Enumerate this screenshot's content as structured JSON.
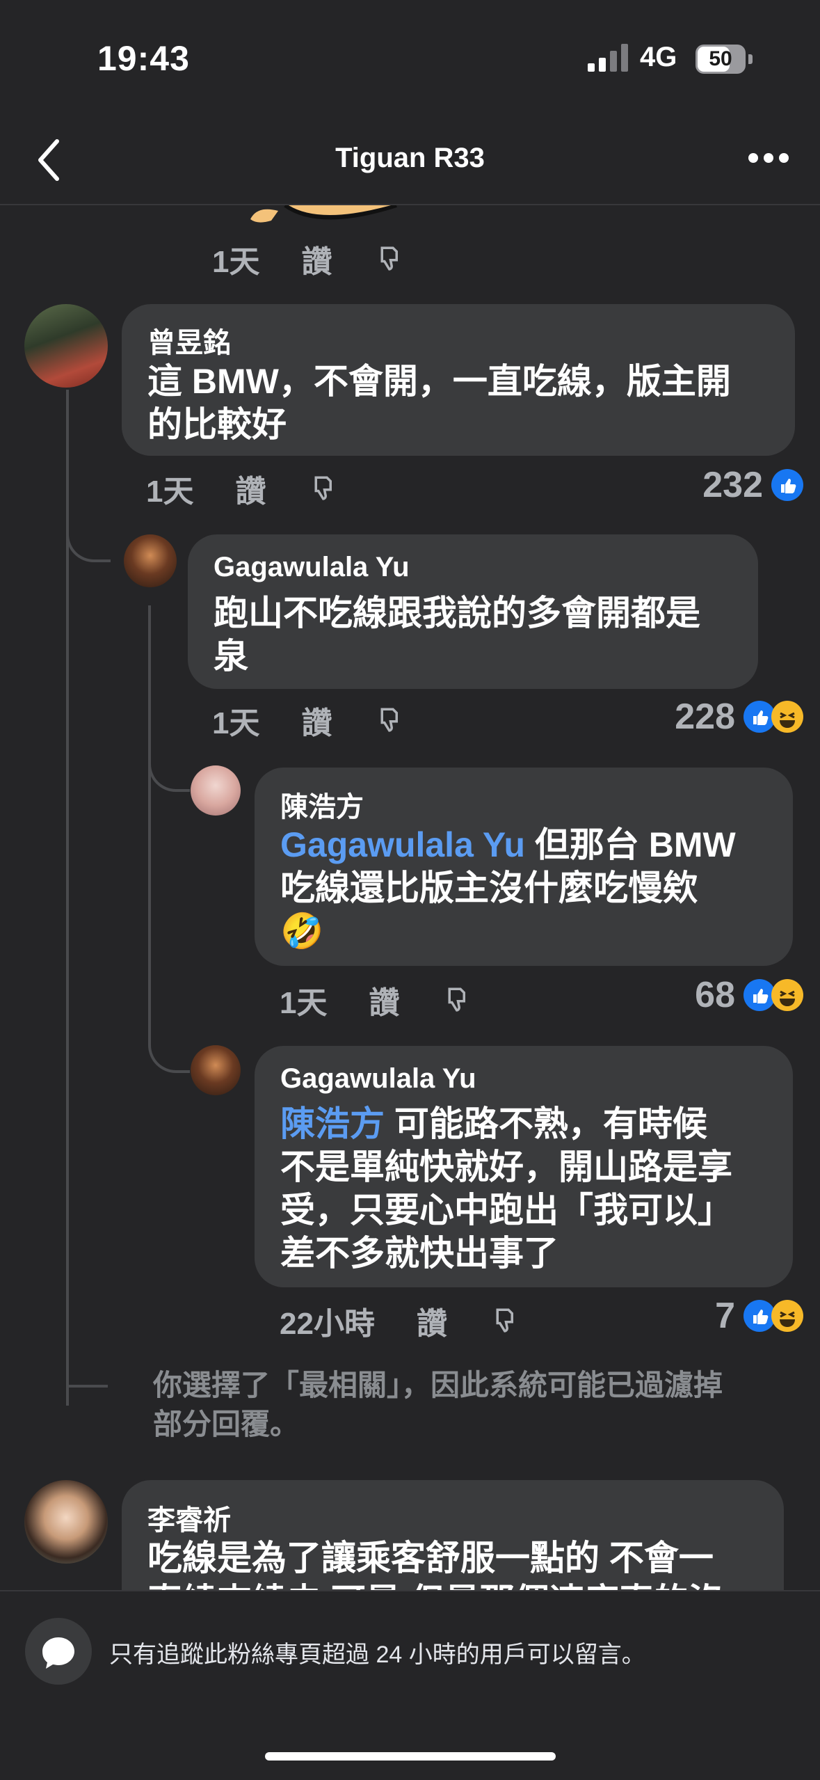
{
  "status_bar": {
    "time": "19:43",
    "network": "4G",
    "battery": "50"
  },
  "header": {
    "title": "Tiguan R33"
  },
  "prev_comment_meta": {
    "time": "1天",
    "like": "讚"
  },
  "comments": [
    {
      "author": "曾昱銘",
      "line1": "這 BMW，不會開，一直吃線，版主開",
      "line2": "的比較好",
      "time": "1天",
      "like": "讚",
      "count": "232"
    },
    {
      "author": "Gagawulala Yu",
      "line1": "跑山不吃線跟我說的多會開都是",
      "line2": "泉",
      "time": "1天",
      "like": "讚",
      "count": "228"
    },
    {
      "author": "陳浩方",
      "mention": "Gagawulala Yu",
      "line1_rest": " 但那台 BMW",
      "line2": "吃線還比版主沒什麼吃慢欸",
      "emoji": "🤣",
      "time": "1天",
      "like": "讚",
      "count": "68"
    },
    {
      "author": "Gagawulala Yu",
      "mention": "陳浩方",
      "line1_rest": " 可能路不熟，有時候",
      "line2": "不是單純快就好，開山路是享",
      "line3": "受，只要心中跑出「我可以」",
      "line4": "差不多就快出事了",
      "time": "22小時",
      "like": "讚",
      "count": "7"
    },
    {
      "author": "李睿祈",
      "line1": "吃線是為了讓乘客舒服一點的 不會一",
      "line2": "直繞來繞去 可是 但是那個速度真的沒"
    }
  ],
  "filter_notice": {
    "line1": "你選擇了「最相關」，因此系統可能已過濾掉",
    "line2": "部分回覆。"
  },
  "footer": {
    "text": "只有追蹤此粉絲專頁超過 24 小時的用戶可以留言。"
  },
  "icons": [
    "back-icon",
    "more-icon",
    "dislike-icon",
    "like-reaction-icon",
    "haha-reaction-icon",
    "chat-bubble-icon"
  ]
}
